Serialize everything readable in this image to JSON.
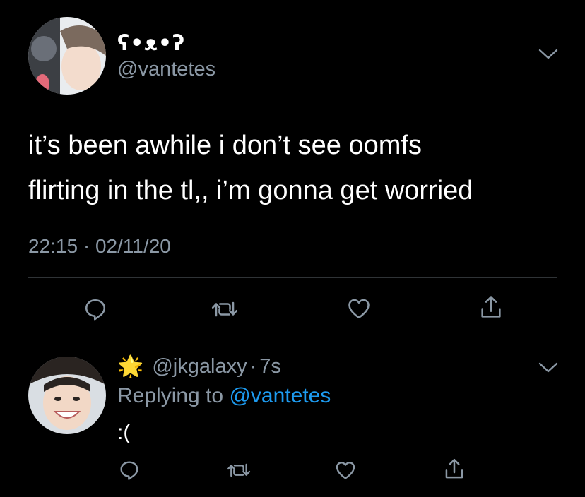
{
  "tweet": {
    "display_name": "ʕ•ᴥ•ʔ",
    "handle": "@vantetes",
    "text_line1": "it’s been awhile i don’t see oomfs",
    "text_line2": "flirting in the tl,, i’m gonna get worried",
    "timestamp": "22:15 · 02/11/20"
  },
  "reply": {
    "handle": "@jkgalaxy",
    "dot": "·",
    "time": "7s",
    "replying_prefix": "Replying to ",
    "replying_to": "@vantetes",
    "text": ":("
  },
  "icons": {
    "main_actions": [
      "reply-icon",
      "retweet-icon",
      "like-icon",
      "share-icon"
    ],
    "reply_actions": [
      "reply-icon",
      "retweet-icon",
      "like-icon",
      "share-icon"
    ]
  },
  "colors": {
    "background": "#000000",
    "secondary_text": "#8b98a5",
    "link": "#1d9bf0"
  }
}
